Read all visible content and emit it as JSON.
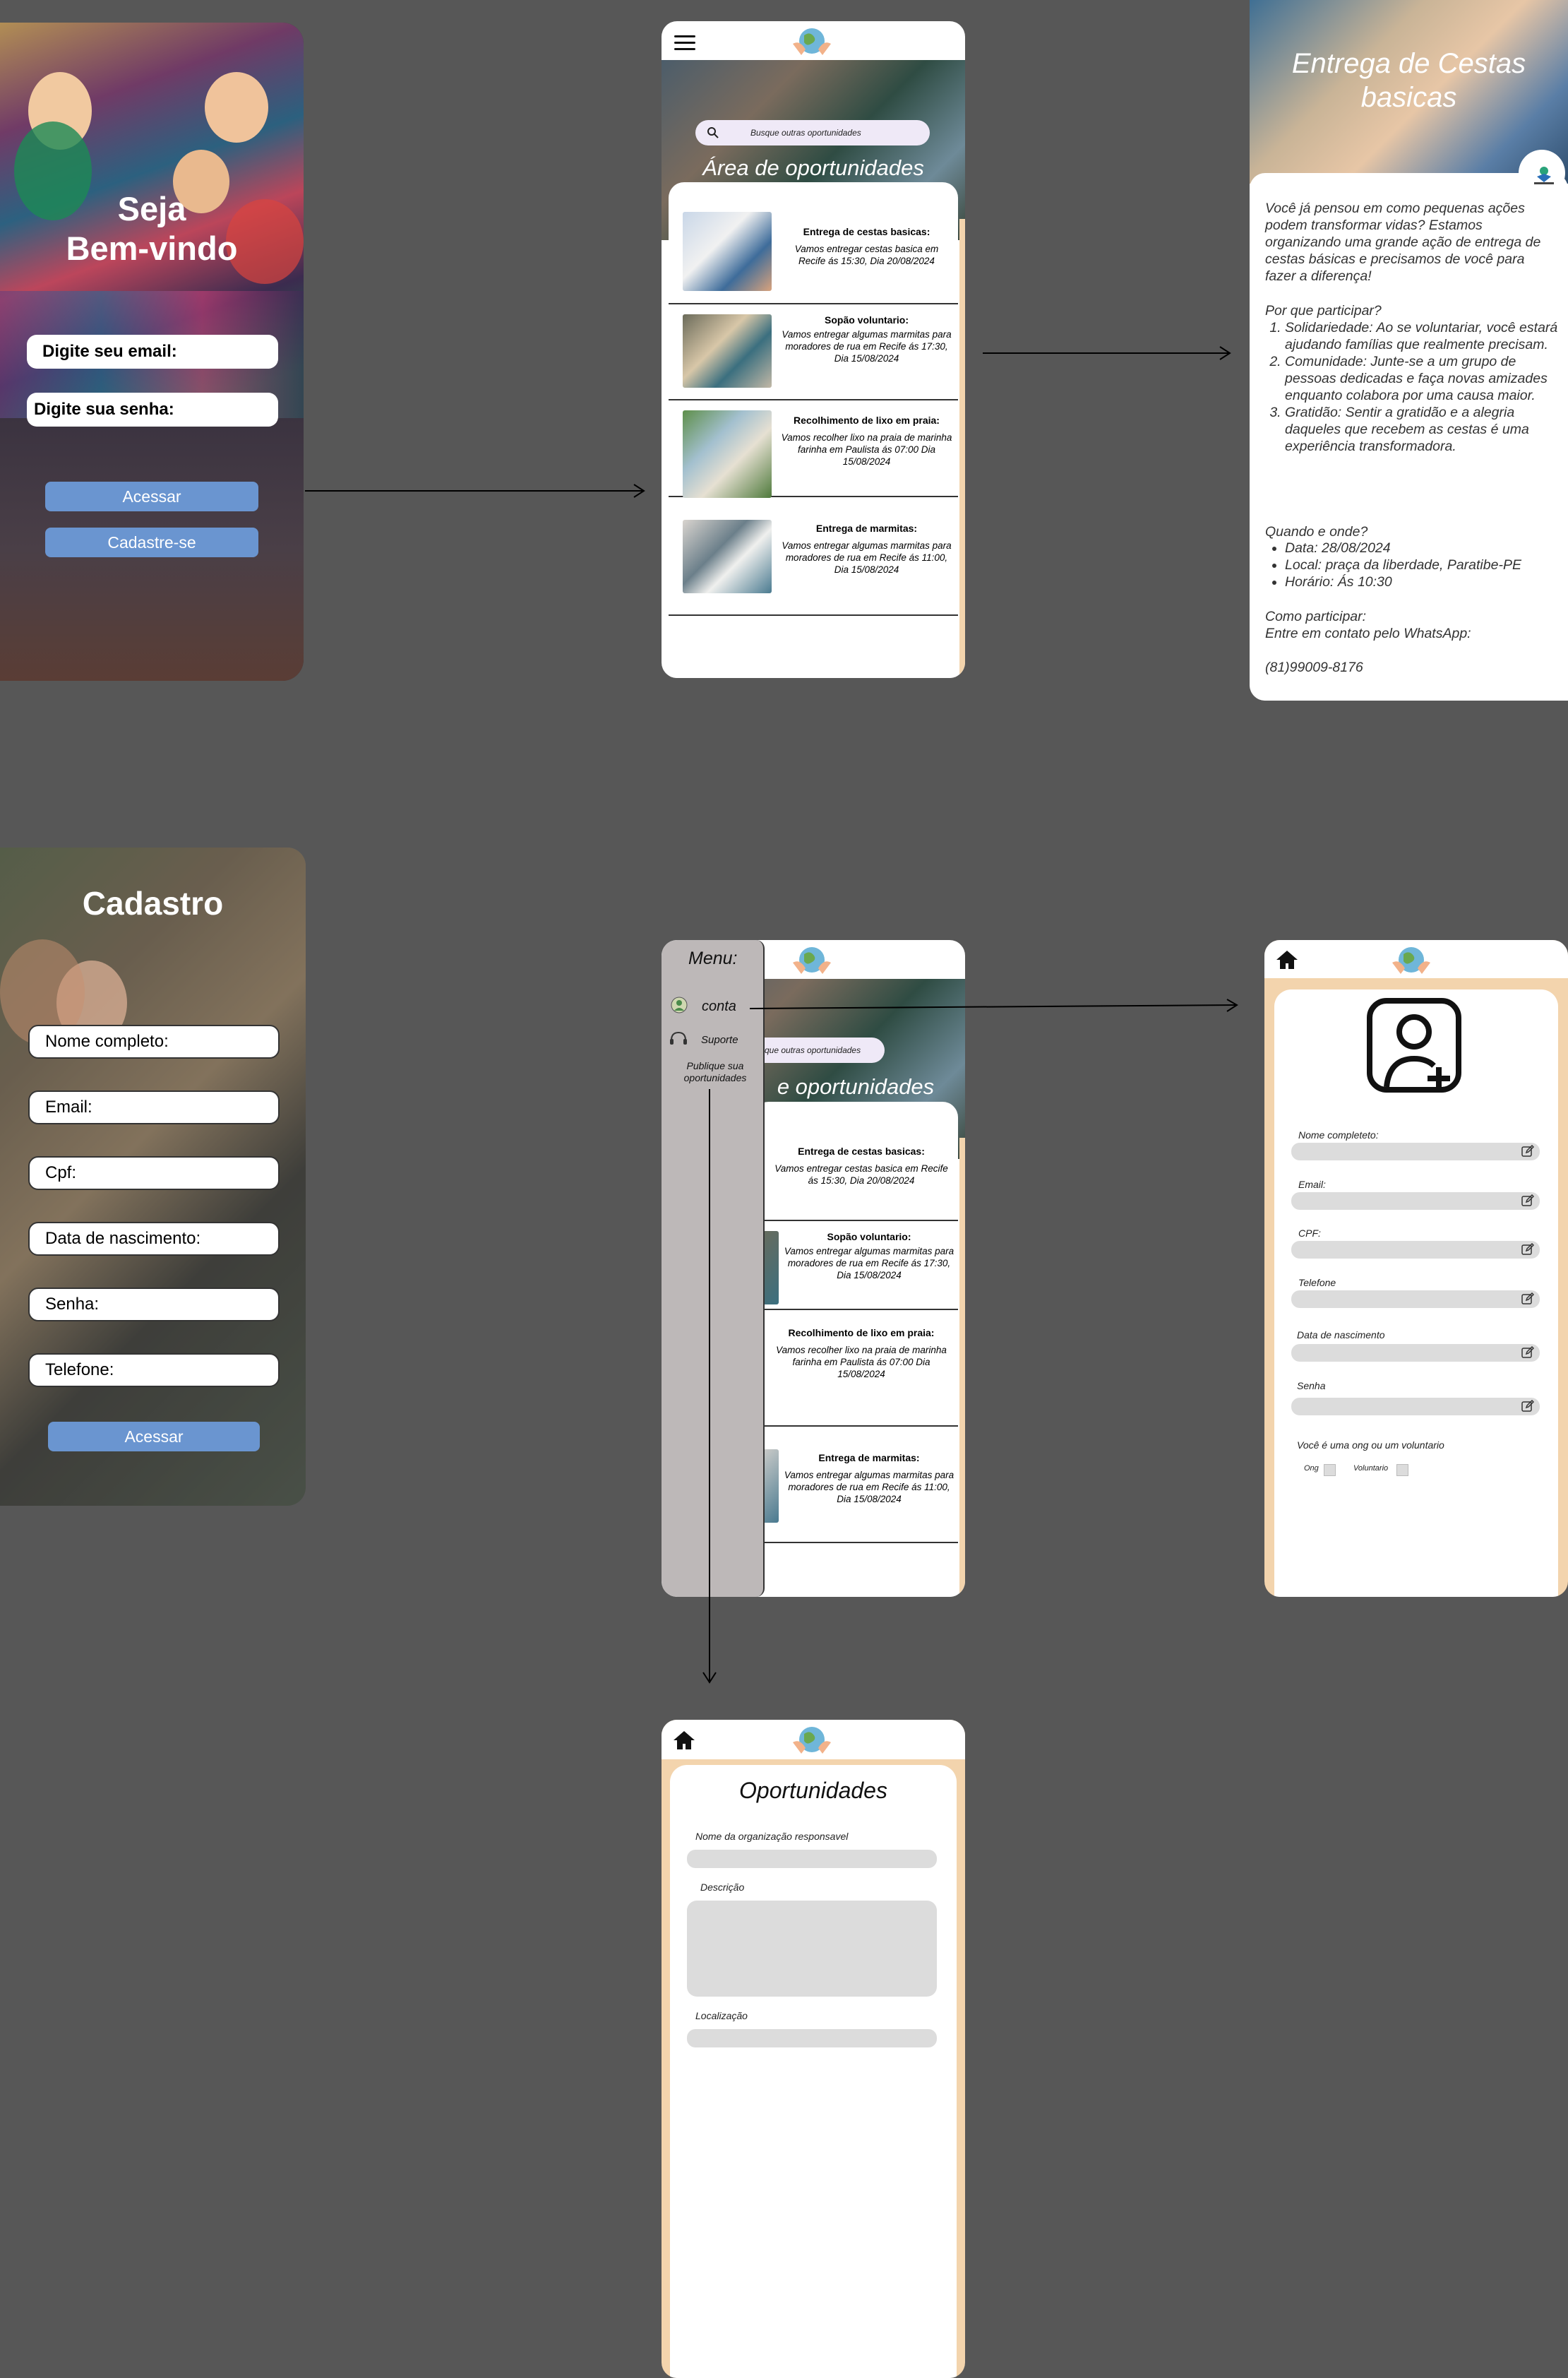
{
  "welcome": {
    "title_line1": "Seja",
    "title_line2": "Bem-vindo",
    "email_placeholder": "Digite seu email:",
    "password_placeholder": "Digite sua senha:",
    "login_button": "Acessar",
    "signup_button": "Cadastre-se"
  },
  "home": {
    "search_placeholder": "Busque outras oportunidades",
    "area_title": "Área de oportunidades",
    "opportunities": [
      {
        "title": "Entrega de cestas basicas:",
        "desc": "Vamos entregar cestas basica em Recife ás 15:30, Dia 20/08/2024"
      },
      {
        "title": "Sopão  voluntario:",
        "desc": "Vamos entregar algumas marmitas para moradores de rua em Recife ás 17:30, Dia 15/08/2024"
      },
      {
        "title": "Recolhimento de lixo em praia:",
        "desc": "Vamos recolher lixo na praia de marinha farinha em Paulista ás 07:00 Dia 15/08/2024"
      },
      {
        "title": "Entrega de marmitas:",
        "desc": "Vamos entregar algumas marmitas para moradores de rua em Recife ás 11:00, Dia 15/08/2024"
      }
    ]
  },
  "detail": {
    "title_line1": "Entrega de Cestas",
    "title_line2": "basicas",
    "intro": "Você já pensou em como pequenas ações podem transformar vidas? Estamos organizando uma grande ação de entrega de cestas básicas e precisamos de você para fazer a diferença!",
    "why_heading": "Por que participar?",
    "reasons": [
      "Solidariedade: Ao se voluntariar, você estará ajudando famílias que realmente precisam.",
      "Comunidade: Junte-se a um grupo de pessoas dedicadas e faça novas amizades enquanto colabora por uma causa maior.",
      "Gratidão: Sentir a gratidão e a alegria daqueles que recebem as cestas é uma experiência transformadora."
    ],
    "when_heading": "Quando e onde?",
    "when_items": [
      "Data: 28/08/2024",
      "Local: praça da liberdade, Paratibe-PE",
      "Horário: Ás 10:30"
    ],
    "how_heading": "Como participar:",
    "how_text": "Entre em contato pelo WhatsApp:",
    "phone": "(81)99009-8176"
  },
  "signup": {
    "title": "Cadastro",
    "fields": [
      "Nome completo:",
      "Email:",
      "Cpf:",
      "Data de nascimento:",
      "Senha:",
      "Telefone:"
    ],
    "submit": "Acessar"
  },
  "menu": {
    "title": "Menu:",
    "account": "conta",
    "support": "Suporte",
    "publish": "Publique sua oportunidades",
    "area_title_partial": "e oportunidades",
    "search_partial": "sque outras oportunidades"
  },
  "profile": {
    "labels": [
      "Nome completeto:",
      "Email:",
      "CPF:",
      "Telefone",
      "Data de nascimento",
      "Senha"
    ],
    "question": "Você é uma ong ou um voluntario",
    "option_ong": "Ong",
    "option_volunteer": "Voluntario"
  },
  "publish_form": {
    "title": "Oportunidades",
    "org_label": "Nome da organização responsavel",
    "desc_label": "Descrição",
    "location_label": "Localização"
  },
  "colors": {
    "background": "#575757",
    "accent_blue": "#6a95d0",
    "beige": "#f3d4ad",
    "menu_gray": "#bdb8b8",
    "field_gray": "#dcdcdc"
  }
}
